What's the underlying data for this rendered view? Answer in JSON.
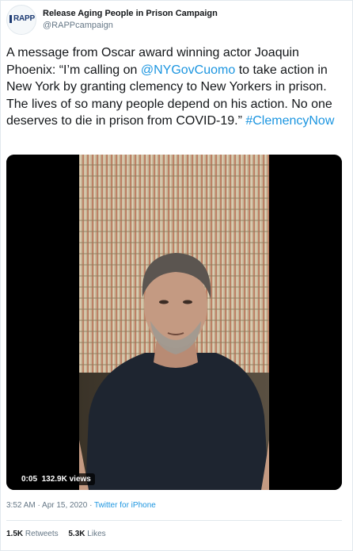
{
  "tweet": {
    "author": {
      "display_name": "Release Aging People in Prison Campaign",
      "handle": "@RAPPcampaign",
      "avatar_text": "RAPP"
    },
    "text": {
      "part1": "A message from Oscar award winning actor Joaquin Phoenix: “I’m calling on ",
      "mention": "@NYGovCuomo",
      "part2": " to take action in New York by granting clemency to New Yorkers in prison. The lives of so many people depend on his action. No one deserves to die in prison from COVID-19.” ",
      "hashtag": "#ClemencyNow"
    },
    "video": {
      "time": "0:05",
      "views": "132.9K views"
    },
    "meta": {
      "timestamp": "3:52 AM · Apr 15, 2020 · ",
      "source": "Twitter for iPhone"
    },
    "stats": {
      "retweets_count": "1.5K",
      "retweets_label": "Retweets",
      "likes_count": "5.3K",
      "likes_label": "Likes"
    }
  },
  "colors": {
    "link": "#1b95e0",
    "text": "#14171a",
    "secondary": "#657786",
    "border": "#e1e8ed"
  }
}
